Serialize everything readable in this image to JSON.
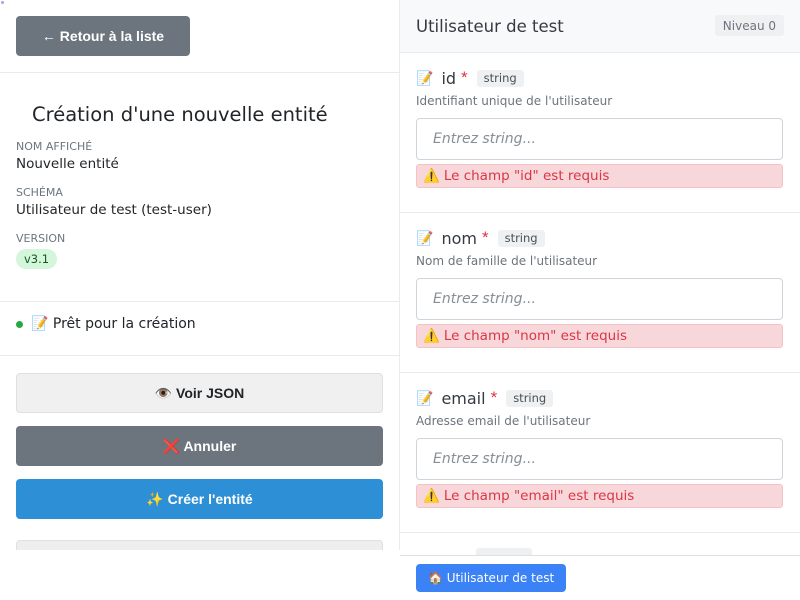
{
  "left": {
    "back_label": "← Retour à la liste",
    "title": "Création d'une nouvelle entité",
    "display_name_label": "NOM AFFICHÉ",
    "display_name_value": "Nouvelle entité",
    "schema_label": "SCHÉMA",
    "schema_value": "Utilisateur de test (test-user)",
    "version_label": "VERSION",
    "version_value": "v3.1",
    "status_text": "📝 Prêt pour la création",
    "status_color": "#28a745",
    "view_json_label": "👁️ Voir JSON",
    "cancel_label": "❌ Annuler",
    "create_label": "✨ Créer l'entité"
  },
  "right": {
    "title": "Utilisateur de test",
    "level": "Niveau 0",
    "fields": [
      {
        "icon": "📝",
        "name": "id",
        "required": "*",
        "type": "string",
        "description": "Identifiant unique de l'utilisateur",
        "placeholder": "Entrez string...",
        "error": "Le champ \"id\" est requis"
      },
      {
        "icon": "📝",
        "name": "nom",
        "required": "*",
        "type": "string",
        "description": "Nom de famille de l'utilisateur",
        "placeholder": "Entrez string...",
        "error": "Le champ \"nom\" est requis"
      },
      {
        "icon": "📝",
        "name": "email",
        "required": "*",
        "type": "string",
        "description": "Adresse email de l'utilisateur",
        "placeholder": "Entrez string...",
        "error": "Le champ \"email\" est requis"
      }
    ],
    "warning_icon": "⚠️"
  },
  "breadcrumb": {
    "label": "🏠 Utilisateur de test"
  },
  "colors": {
    "primary": "#2d8fd5",
    "secondary": "#6c757d",
    "danger": "#dc3545",
    "breadcrumb": "#3b82f6"
  }
}
